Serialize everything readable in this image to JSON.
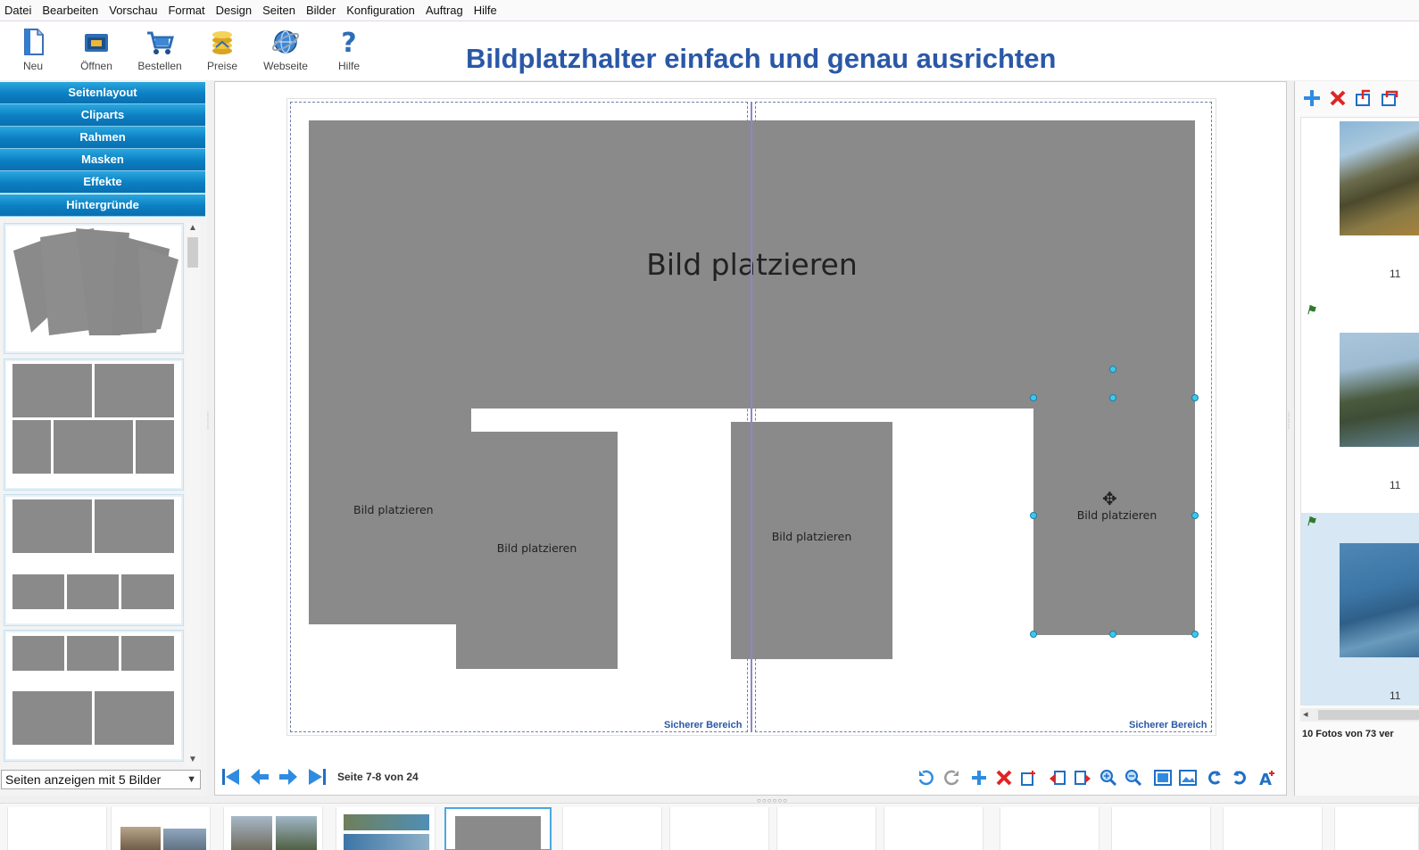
{
  "menu": [
    "Datei",
    "Bearbeiten",
    "Vorschau",
    "Format",
    "Design",
    "Seiten",
    "Bilder",
    "Konfiguration",
    "Auftrag",
    "Hilfe"
  ],
  "toolbar": {
    "buttons": [
      {
        "label": "Neu",
        "icon": "new-document-icon"
      },
      {
        "label": "Öffnen",
        "icon": "open-folder-icon"
      },
      {
        "label": "Bestellen",
        "icon": "cart-icon"
      },
      {
        "label": "Preise",
        "icon": "coins-icon"
      },
      {
        "label": "Webseite",
        "icon": "globe-icon"
      },
      {
        "label": "Hilfe",
        "icon": "help-icon"
      }
    ]
  },
  "headline": "Bildplatzhalter einfach und genau ausrichten",
  "left_panel": {
    "sections": [
      "Seitenlayout",
      "Cliparts",
      "Rahmen",
      "Masken",
      "Effekte",
      "Hintergründe"
    ],
    "layout_select": "Seiten anzeigen mit 5 Bilder"
  },
  "editor": {
    "placeholder_text": "Bild platzieren",
    "safe_area_label": "Sicherer Bereich",
    "page_info": "Seite 7-8 von 24"
  },
  "right_panel": {
    "photo_numbers": [
      "11",
      "11",
      "11"
    ],
    "photo_count": "10 Fotos von 73 ver"
  },
  "colors": {
    "accent": "#2a58a6",
    "accordion": "#0b7fc2",
    "placeholder": "#8a8a8a",
    "handle": "#3ec8ef"
  }
}
